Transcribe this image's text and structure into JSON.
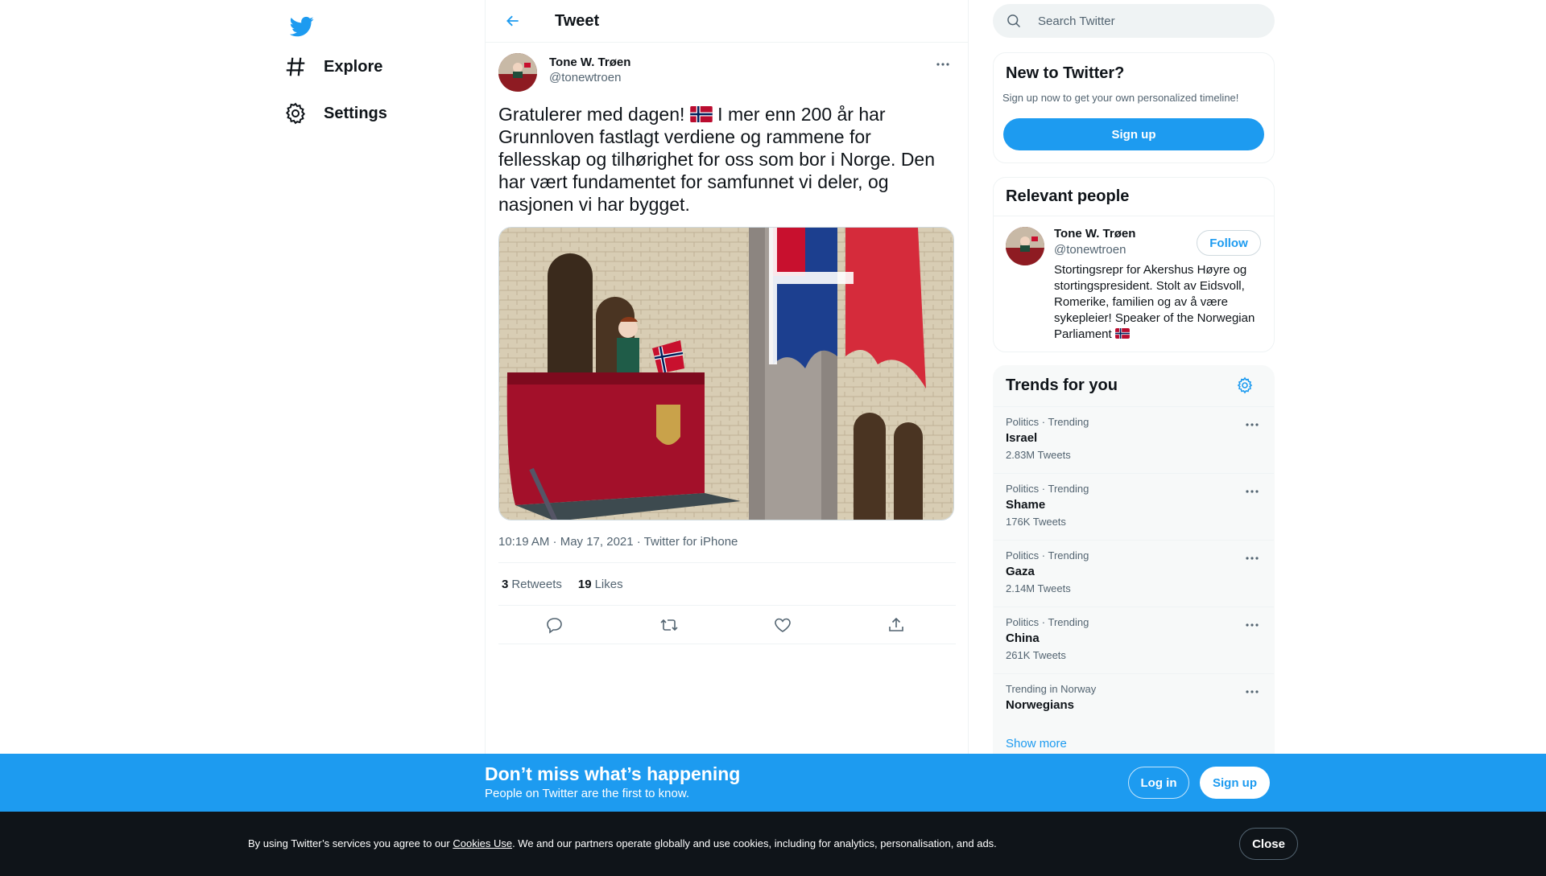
{
  "nav": {
    "items": [
      {
        "label": "Explore",
        "icon": "hashtag-icon"
      },
      {
        "label": "Settings",
        "icon": "gear-icon"
      }
    ]
  },
  "header": {
    "title": "Tweet"
  },
  "tweet": {
    "author_name": "Tone W. Trøen",
    "author_handle": "@tonewtroen",
    "text_part1": "Gratulerer med dagen! ",
    "text_part2": " I mer enn 200 år har Grunnloven fastlagt verdiene og rammene for fellesskap og tilhørighet for oss som bor i Norge. Den har vært fundamentet for samfunnet vi deler, og nasjonen vi har bygget.",
    "time": "10:19 AM · May 17, 2021",
    "sep": " · ",
    "source": "Twitter for iPhone",
    "retweets_count": "3",
    "retweets_label": "Retweets",
    "likes_count": "19",
    "likes_label": "Likes"
  },
  "search": {
    "placeholder": "Search Twitter"
  },
  "new_to_twitter": {
    "title": "New to Twitter?",
    "subtitle": "Sign up now to get your own personalized timeline!",
    "button": "Sign up"
  },
  "relevant_people": {
    "title": "Relevant people",
    "name": "Tone W. Trøen",
    "handle": "@tonewtroen",
    "follow": "Follow",
    "bio": "Stortingsrepr for Akershus Høyre og stortingspresident. Stolt av Eidsvoll, Romerike, familien og av å være sykepleier! Speaker of the Norwegian Parliament "
  },
  "trends": {
    "title": "Trends for you",
    "items": [
      {
        "category": "Politics · Trending",
        "name": "Israel",
        "count": "2.83M Tweets"
      },
      {
        "category": "Politics · Trending",
        "name": "Shame",
        "count": "176K Tweets"
      },
      {
        "category": "Politics · Trending",
        "name": "Gaza",
        "count": "2.14M Tweets"
      },
      {
        "category": "Politics · Trending",
        "name": "China",
        "count": "261K Tweets"
      },
      {
        "category": "Trending in Norway",
        "name": "Norwegians",
        "count": ""
      }
    ],
    "show_more": "Show more"
  },
  "banner": {
    "title": "Don’t miss what’s happening",
    "subtitle": "People on Twitter are the first to know.",
    "login": "Log in",
    "signup": "Sign up"
  },
  "cookie": {
    "before": "By using Twitter’s services you agree to our ",
    "link": "Cookies Use",
    "after": ". We and our partners operate globally and use cookies, including for analytics, personalisation, and ads.",
    "close": "Close"
  },
  "colors": {
    "accent": "#1d9bf0",
    "text": "#0f1419",
    "muted": "#536471",
    "cookie_bg": "#0f1419"
  }
}
